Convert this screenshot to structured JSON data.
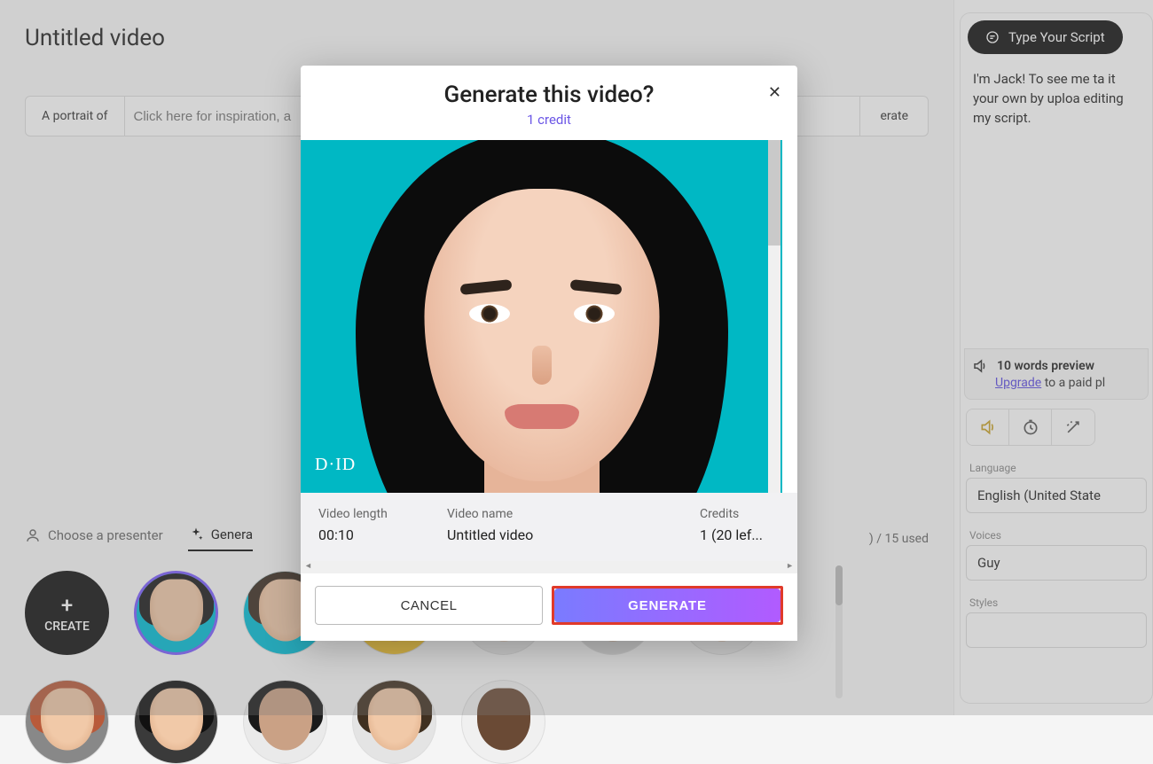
{
  "page": {
    "title": "Untitled video",
    "prompt_prefix": "A portrait of",
    "prompt_placeholder": "Click here for inspiration, a",
    "prompt_generate_label": "erate",
    "credits_used": ") / 15 used",
    "tab_choose": "Choose a presenter",
    "tab_generate": "Genera",
    "create_label": "CREATE"
  },
  "modal": {
    "title": "Generate this video?",
    "credit_line": "1 credit",
    "logo": "D·ID",
    "video_length_label": "Video length",
    "video_length_value": "00:10",
    "video_name_label": "Video name",
    "video_name_value": "Untitled video",
    "credits_label": "Credits",
    "credits_value": "1 (20 lef...",
    "cancel_label": "CANCEL",
    "generate_label": "GENERATE"
  },
  "right": {
    "script_tab": "Type Your Script",
    "script_text": "I'm Jack! To see me ta it your own by uploa editing my script.",
    "preview_words": "10 words preview",
    "upgrade_link": "Upgrade",
    "upgrade_rest": " to a paid pl",
    "language_label": "Language",
    "language_value": "English (United State",
    "voices_label": "Voices",
    "voices_value": "Guy",
    "styles_label": "Styles"
  }
}
